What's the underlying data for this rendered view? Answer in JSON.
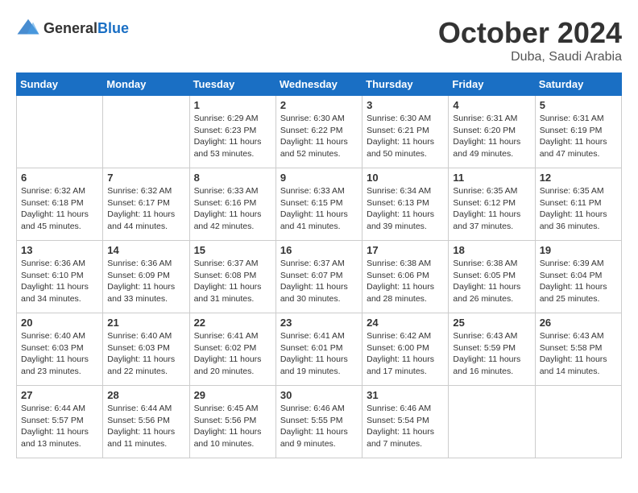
{
  "header": {
    "logo_general": "General",
    "logo_blue": "Blue",
    "month": "October 2024",
    "location": "Duba, Saudi Arabia"
  },
  "weekdays": [
    "Sunday",
    "Monday",
    "Tuesday",
    "Wednesday",
    "Thursday",
    "Friday",
    "Saturday"
  ],
  "weeks": [
    [
      {
        "day": "",
        "info": ""
      },
      {
        "day": "",
        "info": ""
      },
      {
        "day": "1",
        "info": "Sunrise: 6:29 AM\nSunset: 6:23 PM\nDaylight: 11 hours and 53 minutes."
      },
      {
        "day": "2",
        "info": "Sunrise: 6:30 AM\nSunset: 6:22 PM\nDaylight: 11 hours and 52 minutes."
      },
      {
        "day": "3",
        "info": "Sunrise: 6:30 AM\nSunset: 6:21 PM\nDaylight: 11 hours and 50 minutes."
      },
      {
        "day": "4",
        "info": "Sunrise: 6:31 AM\nSunset: 6:20 PM\nDaylight: 11 hours and 49 minutes."
      },
      {
        "day": "5",
        "info": "Sunrise: 6:31 AM\nSunset: 6:19 PM\nDaylight: 11 hours and 47 minutes."
      }
    ],
    [
      {
        "day": "6",
        "info": "Sunrise: 6:32 AM\nSunset: 6:18 PM\nDaylight: 11 hours and 45 minutes."
      },
      {
        "day": "7",
        "info": "Sunrise: 6:32 AM\nSunset: 6:17 PM\nDaylight: 11 hours and 44 minutes."
      },
      {
        "day": "8",
        "info": "Sunrise: 6:33 AM\nSunset: 6:16 PM\nDaylight: 11 hours and 42 minutes."
      },
      {
        "day": "9",
        "info": "Sunrise: 6:33 AM\nSunset: 6:15 PM\nDaylight: 11 hours and 41 minutes."
      },
      {
        "day": "10",
        "info": "Sunrise: 6:34 AM\nSunset: 6:13 PM\nDaylight: 11 hours and 39 minutes."
      },
      {
        "day": "11",
        "info": "Sunrise: 6:35 AM\nSunset: 6:12 PM\nDaylight: 11 hours and 37 minutes."
      },
      {
        "day": "12",
        "info": "Sunrise: 6:35 AM\nSunset: 6:11 PM\nDaylight: 11 hours and 36 minutes."
      }
    ],
    [
      {
        "day": "13",
        "info": "Sunrise: 6:36 AM\nSunset: 6:10 PM\nDaylight: 11 hours and 34 minutes."
      },
      {
        "day": "14",
        "info": "Sunrise: 6:36 AM\nSunset: 6:09 PM\nDaylight: 11 hours and 33 minutes."
      },
      {
        "day": "15",
        "info": "Sunrise: 6:37 AM\nSunset: 6:08 PM\nDaylight: 11 hours and 31 minutes."
      },
      {
        "day": "16",
        "info": "Sunrise: 6:37 AM\nSunset: 6:07 PM\nDaylight: 11 hours and 30 minutes."
      },
      {
        "day": "17",
        "info": "Sunrise: 6:38 AM\nSunset: 6:06 PM\nDaylight: 11 hours and 28 minutes."
      },
      {
        "day": "18",
        "info": "Sunrise: 6:38 AM\nSunset: 6:05 PM\nDaylight: 11 hours and 26 minutes."
      },
      {
        "day": "19",
        "info": "Sunrise: 6:39 AM\nSunset: 6:04 PM\nDaylight: 11 hours and 25 minutes."
      }
    ],
    [
      {
        "day": "20",
        "info": "Sunrise: 6:40 AM\nSunset: 6:03 PM\nDaylight: 11 hours and 23 minutes."
      },
      {
        "day": "21",
        "info": "Sunrise: 6:40 AM\nSunset: 6:03 PM\nDaylight: 11 hours and 22 minutes."
      },
      {
        "day": "22",
        "info": "Sunrise: 6:41 AM\nSunset: 6:02 PM\nDaylight: 11 hours and 20 minutes."
      },
      {
        "day": "23",
        "info": "Sunrise: 6:41 AM\nSunset: 6:01 PM\nDaylight: 11 hours and 19 minutes."
      },
      {
        "day": "24",
        "info": "Sunrise: 6:42 AM\nSunset: 6:00 PM\nDaylight: 11 hours and 17 minutes."
      },
      {
        "day": "25",
        "info": "Sunrise: 6:43 AM\nSunset: 5:59 PM\nDaylight: 11 hours and 16 minutes."
      },
      {
        "day": "26",
        "info": "Sunrise: 6:43 AM\nSunset: 5:58 PM\nDaylight: 11 hours and 14 minutes."
      }
    ],
    [
      {
        "day": "27",
        "info": "Sunrise: 6:44 AM\nSunset: 5:57 PM\nDaylight: 11 hours and 13 minutes."
      },
      {
        "day": "28",
        "info": "Sunrise: 6:44 AM\nSunset: 5:56 PM\nDaylight: 11 hours and 11 minutes."
      },
      {
        "day": "29",
        "info": "Sunrise: 6:45 AM\nSunset: 5:56 PM\nDaylight: 11 hours and 10 minutes."
      },
      {
        "day": "30",
        "info": "Sunrise: 6:46 AM\nSunset: 5:55 PM\nDaylight: 11 hours and 9 minutes."
      },
      {
        "day": "31",
        "info": "Sunrise: 6:46 AM\nSunset: 5:54 PM\nDaylight: 11 hours and 7 minutes."
      },
      {
        "day": "",
        "info": ""
      },
      {
        "day": "",
        "info": ""
      }
    ]
  ]
}
